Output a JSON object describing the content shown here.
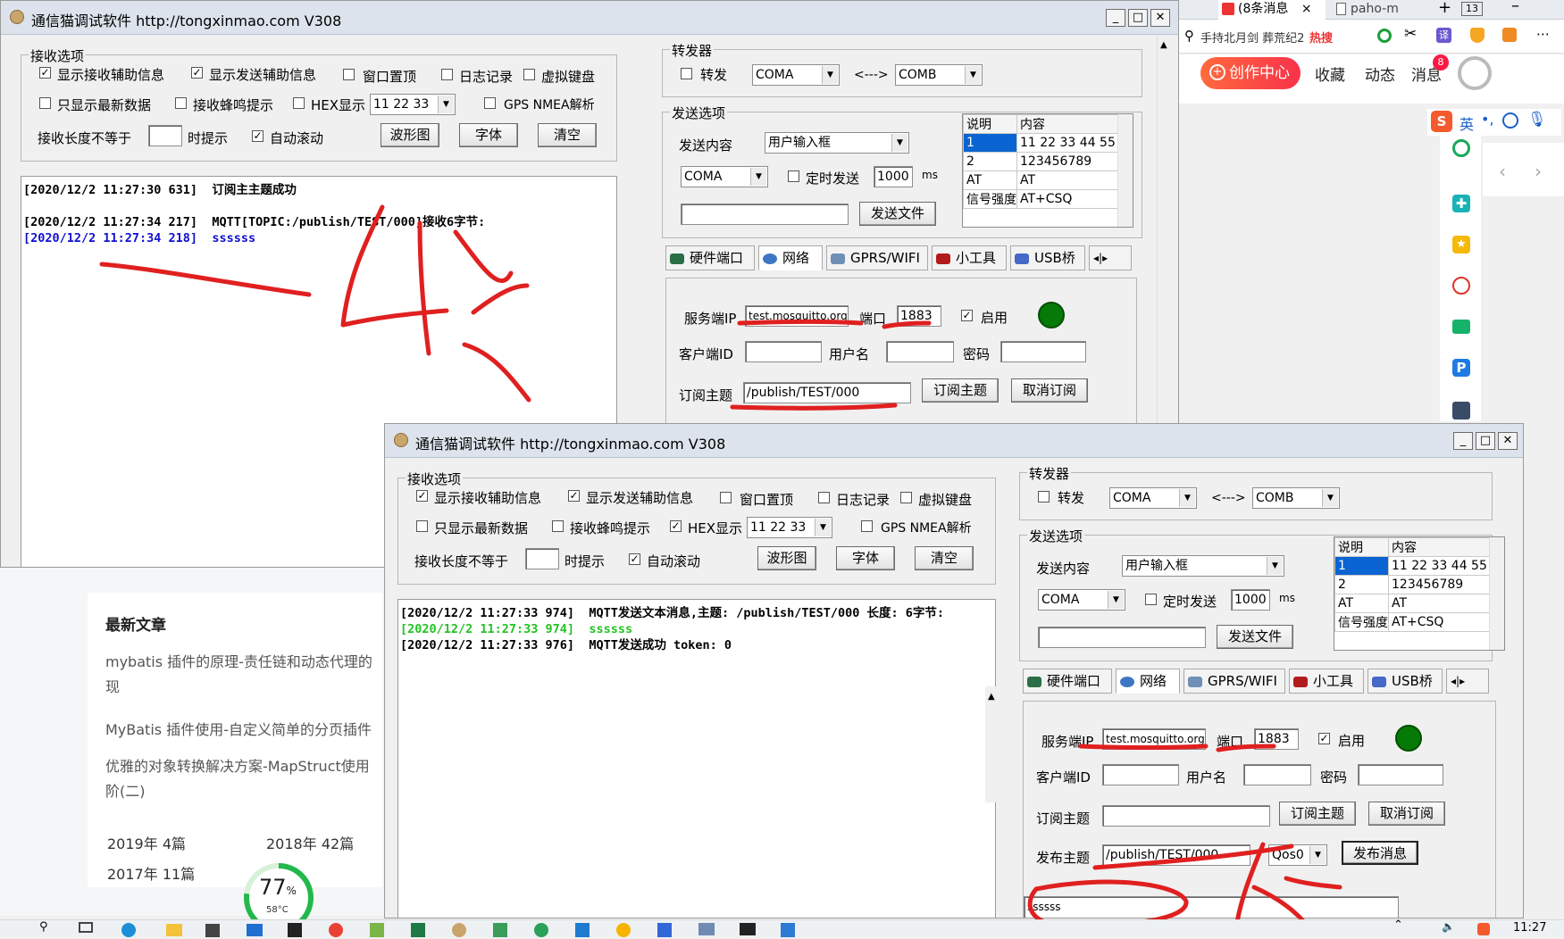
{
  "back_window": {
    "title": "通信猫调试软件 http://tongxinmao.com V308",
    "recv_group": {
      "label": "接收选项",
      "opts": [
        "显示接收辅助信息",
        "显示发送辅助信息",
        "窗口置顶",
        "日志记录",
        "虚拟键盘"
      ],
      "opts2": [
        "只显示最新数据",
        "接收蜂鸣提示",
        "HEX显示",
        "GPS NMEA解析"
      ],
      "hex_value": "11 22 33",
      "len_label": "接收长度不等于",
      "tip_label": "时提示",
      "autoscroll": "自动滚动",
      "btn_wave": "波形图",
      "btn_font": "字体",
      "btn_clear": "清空"
    },
    "log": [
      {
        "time": "[2020/12/2 11:27:30 631]",
        "msg": "订阅主主题成功",
        "color": "#000000"
      },
      {
        "time": "[2020/12/2 11:27:34 217]",
        "msg": "MQTT[TOPIC:/publish/TEST/000]接收6字节:",
        "color": "#000000"
      },
      {
        "time": "[2020/12/2 11:27:34 218]",
        "msg": "ssssss",
        "color": "#1010d0"
      }
    ],
    "forwarder": {
      "label": "转发器",
      "check": "转发",
      "port_a": "COMA",
      "arrow": "<--->",
      "port_b": "COMB"
    },
    "send_opts": {
      "label": "发送选项",
      "content_label": "发送内容",
      "content_value": "用户输入框",
      "port": "COMA",
      "timer_label": "定时发送",
      "interval": "1000",
      "unit": "ms",
      "send_file": "发送文件"
    },
    "table": {
      "headers": [
        "说明",
        "内容"
      ],
      "rows": [
        [
          "1",
          "11 22 33 44 55"
        ],
        [
          "2",
          "123456789"
        ],
        [
          "AT",
          "AT"
        ],
        [
          "信号强度",
          "AT+CSQ"
        ]
      ]
    },
    "tabs": [
      "硬件端口",
      "网络",
      "GPRS/WIFI",
      "小工具",
      "USB桥"
    ],
    "net": {
      "server_ip_label": "服务端IP",
      "server_ip": "test.mosquitto.org",
      "port_label": "端口",
      "port": "1883",
      "enable": "启用",
      "client_id_label": "客户端ID",
      "user_label": "用户名",
      "pwd_label": "密码",
      "sub_topic_label": "订阅主题",
      "sub_topic": "/publish/TEST/000",
      "sub_btn": "订阅主题",
      "unsub_btn": "取消订阅"
    },
    "annotation": "—收"
  },
  "front_window": {
    "title": "通信猫调试软件 http://tongxinmao.com V308",
    "log": [
      {
        "time": "[2020/12/2 11:27:33 974]",
        "msg": "MQTT发送文本消息,主题: /publish/TEST/000 长度: 6字节:",
        "color": "#000000"
      },
      {
        "time": "[2020/12/2 11:27:33 974]",
        "msg": "ssssss",
        "color": "#22c322"
      },
      {
        "time": "[2020/12/2 11:27:33 976]",
        "msg": "MQTT发送成功 token: 0",
        "color": "#000000"
      }
    ],
    "net": {
      "pub_topic_label": "发布主题",
      "pub_topic": "/publish/TEST/000",
      "qos": "Qos0",
      "pub_btn": "发布消息",
      "message": "ssssss"
    },
    "annotation": "发"
  },
  "browser": {
    "tabs": [
      "(8条消息",
      "paho-m"
    ],
    "tab_count": "13",
    "search_hint": "手持北月剑 葬荒纪2",
    "hot": "热搜",
    "nav": [
      "创作中心",
      "收藏",
      "动态",
      "消息"
    ],
    "msg_badge": "8",
    "ime": "英",
    "sidebar_title": "最新文章",
    "articles": [
      "mybatis 插件的原理-责任链和动态代理的现",
      "MyBatis 插件使用-自定义简单的分页插件",
      "优雅的对象转换解决方案-MapStruct使用阶(二)"
    ],
    "archive": [
      [
        "2019年",
        "4篇"
      ],
      [
        "2018年",
        "42篇"
      ],
      [
        "2017年",
        "11篇"
      ]
    ],
    "gauge": {
      "value": "77",
      "unit": "%",
      "temp": "58°C",
      "level": 0.77
    }
  },
  "taskbar": {
    "time": "11:27"
  },
  "colors": {
    "annotation": "#e02020",
    "led": "#067a06",
    "selected": "#0a64d2"
  }
}
